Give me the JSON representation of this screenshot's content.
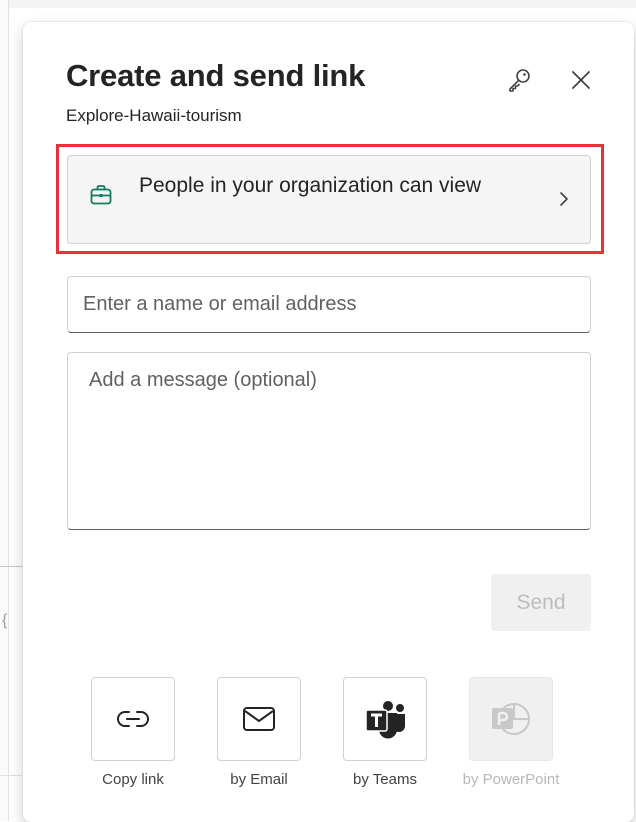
{
  "dialog": {
    "title": "Create and send link",
    "subtitle": "Explore-Hawaii-tourism"
  },
  "permission": {
    "label": "People in your organization can view",
    "icon": "briefcase-icon",
    "accent_color": "#0f7b5f",
    "highlight_color": "#e8313b"
  },
  "recipients": {
    "placeholder": "Enter a name or email address",
    "value": ""
  },
  "message": {
    "placeholder": "Add a message (optional)",
    "value": ""
  },
  "send": {
    "label": "Send",
    "enabled": false
  },
  "share_options": [
    {
      "label": "Copy link",
      "icon": "link-icon",
      "enabled": true
    },
    {
      "label": "by Email",
      "icon": "mail-icon",
      "enabled": true
    },
    {
      "label": "by Teams",
      "icon": "teams-icon",
      "enabled": true
    },
    {
      "label": "by PowerPoint",
      "icon": "powerpoint-icon",
      "enabled": false
    }
  ]
}
